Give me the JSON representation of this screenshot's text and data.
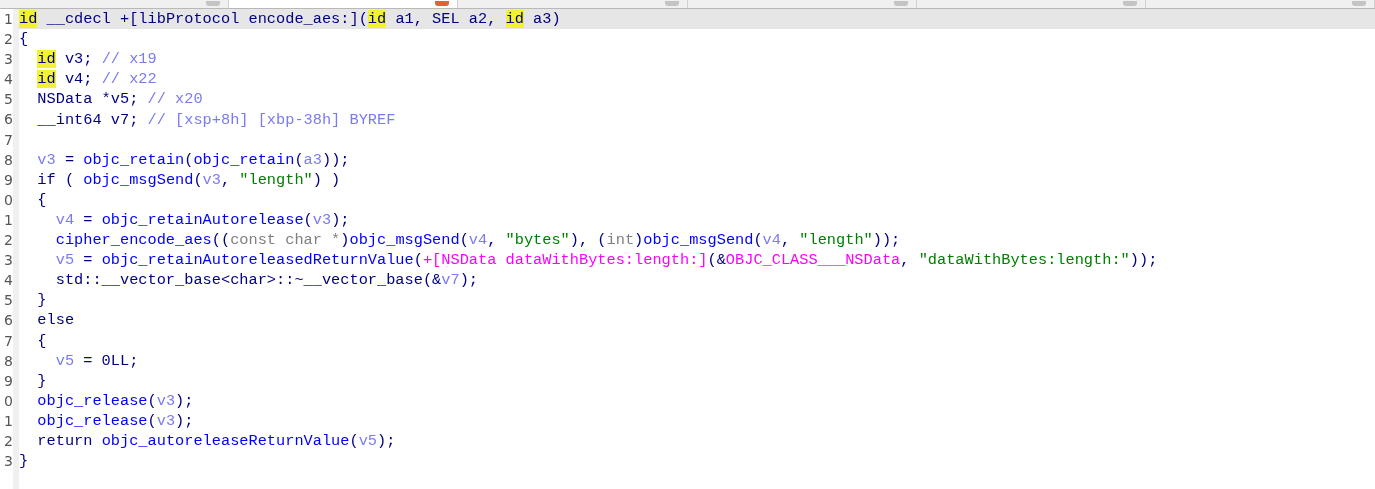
{
  "tabs": [
    {
      "selected": false
    },
    {
      "selected": true
    },
    {
      "selected": false
    },
    {
      "selected": false
    },
    {
      "selected": false
    },
    {
      "selected": false
    }
  ],
  "lines": [
    {
      "number": "1",
      "current": true,
      "tokens": [
        {
          "kind": "hl",
          "text": "id"
        },
        {
          "kind": "text",
          "text": " __cdecl +[libProtocol encode_aes:]("
        },
        {
          "kind": "hl",
          "text": "id"
        },
        {
          "kind": "text",
          "text": " a1, SEL a2, "
        },
        {
          "kind": "hl",
          "text": "id"
        },
        {
          "kind": "text",
          "text": " a3)"
        }
      ]
    },
    {
      "number": "2",
      "current": false,
      "tokens": [
        {
          "kind": "text",
          "text": "{"
        }
      ]
    },
    {
      "number": "3",
      "current": false,
      "tokens": [
        {
          "kind": "hl",
          "text": "  id"
        },
        {
          "kind": "text",
          "text": " v3; "
        },
        {
          "kind": "comment",
          "text": "// x19"
        }
      ]
    },
    {
      "number": "4",
      "current": false,
      "tokens": [
        {
          "kind": "hl",
          "text": "  id"
        },
        {
          "kind": "text",
          "text": " v4; "
        },
        {
          "kind": "comment",
          "text": "// x22"
        }
      ]
    },
    {
      "number": "5",
      "current": false,
      "tokens": [
        {
          "kind": "text",
          "text": "  NSData *v5; "
        },
        {
          "kind": "comment",
          "text": "// x20"
        }
      ]
    },
    {
      "number": "6",
      "current": false,
      "tokens": [
        {
          "kind": "text",
          "text": "  __int64 v7; "
        },
        {
          "kind": "comment",
          "text": "// [xsp+8h] [xbp-38h] BYREF"
        }
      ]
    },
    {
      "number": "7",
      "current": false
    },
    {
      "number": "8",
      "current": false,
      "tokens": [
        {
          "kind": "var",
          "text": "  v3"
        },
        {
          "kind": "text",
          "text": " = "
        },
        {
          "kind": "func",
          "text": "objc_retain"
        },
        {
          "kind": "text",
          "text": "("
        },
        {
          "kind": "func",
          "text": "objc_retain"
        },
        {
          "kind": "text",
          "text": "("
        },
        {
          "kind": "var",
          "text": "a3"
        },
        {
          "kind": "text",
          "text": "));"
        }
      ]
    },
    {
      "number": "9",
      "current": false,
      "tokens": [
        {
          "kind": "text",
          "text": "  if ( "
        },
        {
          "kind": "func",
          "text": "objc_msgSend"
        },
        {
          "kind": "text",
          "text": "("
        },
        {
          "kind": "var",
          "text": "v3"
        },
        {
          "kind": "text",
          "text": ", "
        },
        {
          "kind": "string",
          "text": "\"length\""
        },
        {
          "kind": "text",
          "text": ") )"
        }
      ]
    },
    {
      "number": "0",
      "current": false,
      "tokens": [
        {
          "kind": "text",
          "text": "  {"
        }
      ]
    },
    {
      "number": "1",
      "current": false,
      "tokens": [
        {
          "kind": "var",
          "text": "    v4"
        },
        {
          "kind": "text",
          "text": " = "
        },
        {
          "kind": "func",
          "text": "objc_retainAutorelease"
        },
        {
          "kind": "text",
          "text": "("
        },
        {
          "kind": "var",
          "text": "v3"
        },
        {
          "kind": "text",
          "text": ");"
        }
      ]
    },
    {
      "number": "2",
      "current": false,
      "tokens": [
        {
          "kind": "func",
          "text": "    cipher_encode_aes"
        },
        {
          "kind": "text",
          "text": "(("
        },
        {
          "kind": "cast",
          "text": "const char *"
        },
        {
          "kind": "text",
          "text": ")"
        },
        {
          "kind": "func",
          "text": "objc_msgSend"
        },
        {
          "kind": "text",
          "text": "("
        },
        {
          "kind": "var",
          "text": "v4"
        },
        {
          "kind": "text",
          "text": ", "
        },
        {
          "kind": "string",
          "text": "\"bytes\""
        },
        {
          "kind": "text",
          "text": "), ("
        },
        {
          "kind": "cast",
          "text": "int"
        },
        {
          "kind": "text",
          "text": ")"
        },
        {
          "kind": "func",
          "text": "objc_msgSend"
        },
        {
          "kind": "text",
          "text": "("
        },
        {
          "kind": "var",
          "text": "v4"
        },
        {
          "kind": "text",
          "text": ", "
        },
        {
          "kind": "string",
          "text": "\"length\""
        },
        {
          "kind": "text",
          "text": "));"
        }
      ]
    },
    {
      "number": "3",
      "current": false,
      "tokens": [
        {
          "kind": "var",
          "text": "    v5"
        },
        {
          "kind": "text",
          "text": " = "
        },
        {
          "kind": "func",
          "text": "objc_retainAutoreleasedReturnValue"
        },
        {
          "kind": "text",
          "text": "("
        },
        {
          "kind": "import",
          "text": "+[NSData dataWithBytes:length:]"
        },
        {
          "kind": "text",
          "text": "(&"
        },
        {
          "kind": "import",
          "text": "OBJC_CLASS___NSData"
        },
        {
          "kind": "text",
          "text": ", "
        },
        {
          "kind": "string",
          "text": "\"dataWithBytes:length:\""
        },
        {
          "kind": "text",
          "text": "));"
        }
      ]
    },
    {
      "number": "4",
      "current": false,
      "tokens": [
        {
          "kind": "text",
          "text": "    std::__vector_base<char>::~__vector_base(&"
        },
        {
          "kind": "var",
          "text": "v7"
        },
        {
          "kind": "text",
          "text": ");"
        }
      ]
    },
    {
      "number": "5",
      "current": false,
      "tokens": [
        {
          "kind": "text",
          "text": "  }"
        }
      ]
    },
    {
      "number": "6",
      "current": false,
      "tokens": [
        {
          "kind": "text",
          "text": "  else"
        }
      ]
    },
    {
      "number": "7",
      "current": false,
      "tokens": [
        {
          "kind": "text",
          "text": "  {"
        }
      ]
    },
    {
      "number": "8",
      "current": false,
      "tokens": [
        {
          "kind": "var",
          "text": "    v5"
        },
        {
          "kind": "text",
          "text": " = 0LL;"
        }
      ]
    },
    {
      "number": "9",
      "current": false,
      "tokens": [
        {
          "kind": "text",
          "text": "  }"
        }
      ]
    },
    {
      "number": "0",
      "current": false,
      "tokens": [
        {
          "kind": "func",
          "text": "  objc_release"
        },
        {
          "kind": "text",
          "text": "("
        },
        {
          "kind": "var",
          "text": "v3"
        },
        {
          "kind": "text",
          "text": ");"
        }
      ]
    },
    {
      "number": "1",
      "current": false,
      "tokens": [
        {
          "kind": "func",
          "text": "  objc_release"
        },
        {
          "kind": "text",
          "text": "("
        },
        {
          "kind": "var",
          "text": "v3"
        },
        {
          "kind": "text",
          "text": ");"
        }
      ]
    },
    {
      "number": "2",
      "current": false,
      "tokens": [
        {
          "kind": "text",
          "text": "  return "
        },
        {
          "kind": "func",
          "text": "objc_autoreleaseReturnValue"
        },
        {
          "kind": "text",
          "text": "("
        },
        {
          "kind": "var",
          "text": "v5"
        },
        {
          "kind": "text",
          "text": ");"
        }
      ]
    },
    {
      "number": "3",
      "current": false,
      "tokens": [
        {
          "kind": "text",
          "text": "}"
        }
      ]
    }
  ]
}
